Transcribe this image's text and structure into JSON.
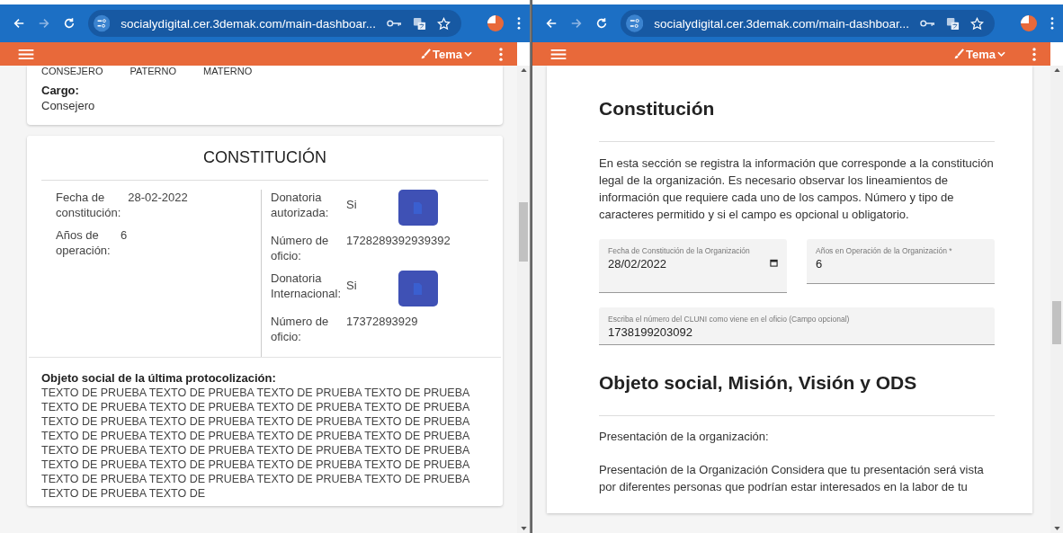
{
  "windows": [
    {
      "kind": "summary",
      "url": "socialydigital.cer.3demak.com/main-dashboar...",
      "theme_label": "Tema",
      "content": {
        "header_fragments": [
          "CONSEJERO",
          "PATERNO",
          "MATERNO"
        ],
        "cargo": {
          "label": "Cargo:",
          "value": "Consejero"
        },
        "constitution": {
          "title": "CONSTITUCIÓN",
          "left_fields": [
            {
              "label": "Fecha de constitución:",
              "value": "28-02-2022"
            },
            {
              "label": "Años de operación:",
              "value": "6"
            }
          ],
          "right_fields": [
            {
              "kind": "document",
              "label": "Donatoria autorizada:",
              "value": "Si"
            },
            {
              "kind": "plain",
              "label": "Número de oficio:",
              "value": "1728289392939392"
            },
            {
              "kind": "document",
              "label": "Donatoria Internacional:",
              "value": "Si"
            },
            {
              "kind": "plain",
              "label": "Número de oficio:",
              "value": "17372893929"
            }
          ]
        },
        "purpose": {
          "label": "Objeto social de la última protocolización:",
          "text": "TEXTO DE PRUEBA TEXTO DE PRUEBA TEXTO DE PRUEBA TEXTO DE PRUEBA TEXTO DE PRUEBA TEXTO DE PRUEBA TEXTO DE PRUEBA TEXTO DE PRUEBA TEXTO DE PRUEBA TEXTO DE PRUEBA TEXTO DE PRUEBA TEXTO DE PRUEBA TEXTO DE PRUEBA TEXTO DE PRUEBA TEXTO DE PRUEBA TEXTO DE PRUEBA TEXTO DE PRUEBA TEXTO DE PRUEBA TEXTO DE PRUEBA TEXTO DE PRUEBA TEXTO DE PRUEBA TEXTO DE PRUEBA TEXTO DE PRUEBA TEXTO DE PRUEBA TEXTO DE PRUEBA TEXTO DE PRUEBA TEXTO DE PRUEBA TEXTO DE PRUEBA TEXTO DE PRUEBA TEXTO DE"
        }
      }
    },
    {
      "kind": "form",
      "url": "socialydigital.cer.3demak.com/main-dashboar...",
      "theme_label": "Tema",
      "content": {
        "title": "Constitución",
        "description": "En esta sección se registra la información que corresponde a la constitución legal de la organización. Es necesario observar los lineamientos de información que requiere cada uno de los campos. Número y tipo de caracteres permitido y si el campo es opcional u obligatorio.",
        "fields": [
          {
            "kind": "date",
            "label": "Fecha de Constitución de la Organización",
            "value": "28/02/2022"
          },
          {
            "kind": "text",
            "label": "Años en Operación de la Organización *",
            "value": "6"
          },
          {
            "kind": "text",
            "label": "Escriba el número del CLUNI como viene en el oficio (Campo opcional)",
            "value": "1738199203092"
          }
        ],
        "section_title": "Objeto social, Misión, Visión y ODS",
        "subtitle": "Presentación de la organización:",
        "text": "Presentación de la Organización Considera que tu presentación será vista por diferentes personas que podrían estar interesados en la labor de tu"
      }
    }
  ]
}
